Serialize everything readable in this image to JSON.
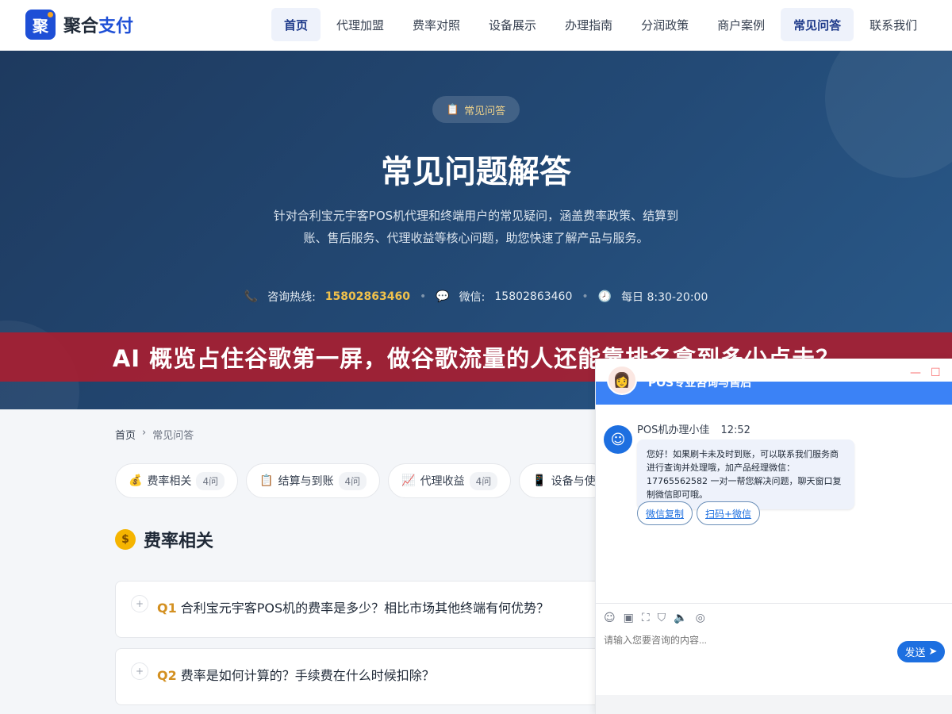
{
  "header": {
    "logo_mark": "聚",
    "logo_text_1": "聚合",
    "logo_text_2": "支付",
    "nav": [
      "首页",
      "代理加盟",
      "费率对照",
      "设备展示",
      "办理指南",
      "分润政策",
      "商户案例",
      "常见问答",
      "联系我们"
    ]
  },
  "hero": {
    "badge": "常见问答",
    "title": "常见问题解答",
    "desc": "针对合利宝元宇客POS机代理和终端用户的常见疑问，涵盖费率政策、结算到账、售后服务、代理收益等核心问题，助您快速了解产品与服务。",
    "hotline_label": "咨询热线:",
    "hotline_number": "15802863460",
    "wechat_label": "微信:",
    "wechat_number": "15802863460",
    "hours": "每日 8:30-20:00"
  },
  "banner": {
    "text": "AI 概览占住谷歌第一屏，做谷歌流量的人还能靠排名拿到多少点击？"
  },
  "breadcrumb": {
    "home": "首页",
    "current": "常见问答"
  },
  "tabs": [
    {
      "label": "费率相关",
      "count": "4问"
    },
    {
      "label": "结算与到账",
      "count": "4问"
    },
    {
      "label": "代理收益",
      "count": "4问"
    },
    {
      "label": "设备与使",
      "count": ""
    }
  ],
  "section": {
    "title": "费率相关"
  },
  "faq": [
    {
      "num": "Q1",
      "question": "合利宝元宇客POS机的费率是多少？相比市场其他终端有何优势？"
    },
    {
      "num": "Q2",
      "question": "费率是如何计算的？手续费在什么时候扣除？"
    }
  ],
  "chat": {
    "title": "POS专业咨询与售后",
    "agent_name": "POS机办理小佳",
    "time": "12:52",
    "message": "您好！如果刷卡未及时到账，可以联系我们服务商进行查询并处理哦，加产品经理微信：17765562582 一对一帮您解决问题，聊天窗口复制微信即可哦。",
    "btn_copy": "微信复制",
    "btn_scan": "扫码+微信",
    "input_placeholder": "请输入您要咨询的内容...",
    "send_label": "发送"
  }
}
